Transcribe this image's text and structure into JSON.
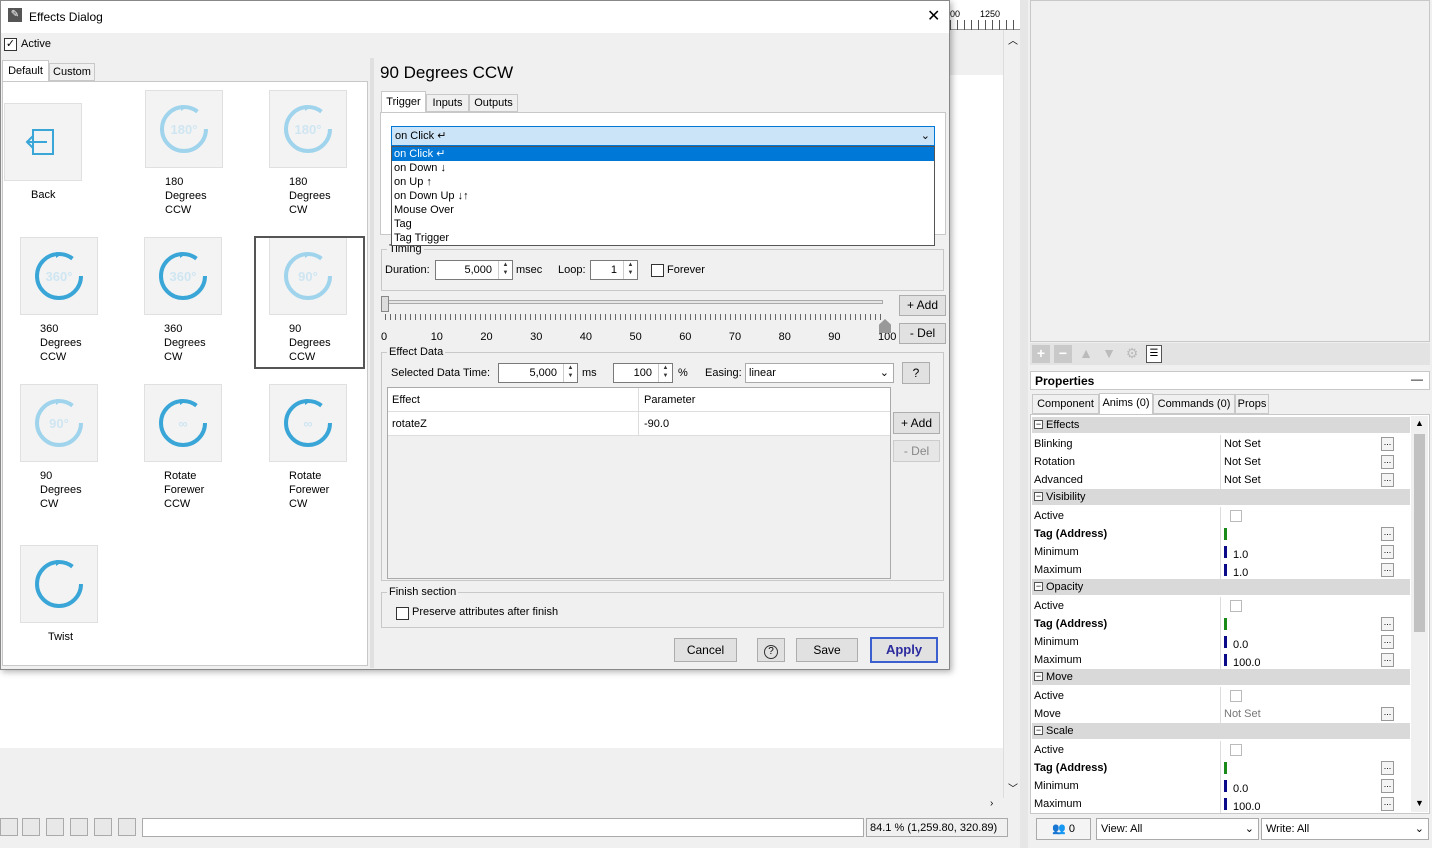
{
  "dialog": {
    "title": "Effects Dialog",
    "active_label": "Active",
    "tabs": [
      "Default",
      "Custom"
    ],
    "tiles": [
      {
        "label": "Back",
        "icon": "back-icon",
        "glyph": ""
      },
      {
        "label": "180\nDegrees\nCCW",
        "icon": "rotate-180-ccw-icon",
        "glyph": "180°"
      },
      {
        "label": "180\nDegrees\nCW",
        "icon": "rotate-180-cw-icon",
        "glyph": "180°"
      },
      {
        "label": "360\nDegrees\nCCW",
        "icon": "rotate-360-ccw-icon",
        "glyph": "360°"
      },
      {
        "label": "360\nDegrees\nCW",
        "icon": "rotate-360-cw-icon",
        "glyph": "360°"
      },
      {
        "label": "90\nDegrees\nCCW",
        "icon": "rotate-90-ccw-icon",
        "glyph": "90°"
      },
      {
        "label": "90\nDegrees\nCW",
        "icon": "rotate-90-cw-icon",
        "glyph": "90°"
      },
      {
        "label": "Rotate\nForewer\nCCW",
        "icon": "rotate-forever-ccw-icon",
        "glyph": "∞"
      },
      {
        "label": "Rotate\nForewer\nCW",
        "icon": "rotate-forever-cw-icon",
        "glyph": "∞"
      },
      {
        "label": "Twist",
        "icon": "twist-icon",
        "glyph": ""
      }
    ],
    "effect_title": "90 Degrees CCW",
    "subtabs": [
      "Trigger",
      "Inputs",
      "Outputs"
    ],
    "trigger_selected": "on Click ↵",
    "trigger_options": [
      "on Click ↵",
      "on Down ↓",
      "on Up ↑",
      "on Down Up ↓↑",
      "Mouse Over",
      "Tag",
      "Tag Trigger"
    ],
    "timing": {
      "legend": "Timing",
      "duration_label": "Duration:",
      "duration_value": "5,000",
      "duration_unit": "msec",
      "loop_label": "Loop:",
      "loop_value": "1",
      "forever_label": "Forever"
    },
    "timeline": {
      "ticks": [
        "0",
        "10",
        "20",
        "30",
        "40",
        "50",
        "60",
        "70",
        "80",
        "90",
        "100"
      ],
      "add_label": "+ Add",
      "del_label": "- Del"
    },
    "effect_data": {
      "legend": "Effect Data",
      "selected_time_label": "Selected Data Time:",
      "selected_time_value": "5,000",
      "ms_label": "ms",
      "percent_value": "100",
      "percent_label": "%",
      "easing_label": "Easing:",
      "easing_value": "linear",
      "help_label": "?",
      "columns": [
        "Effect",
        "Parameter"
      ],
      "rows": [
        {
          "effect": "rotateZ",
          "parameter": "-90.0"
        }
      ],
      "add_label": "+ Add",
      "del_label": "- Del"
    },
    "finish": {
      "legend": "Finish section",
      "preserve_label": "Preserve attributes after finish"
    },
    "buttons": {
      "cancel": "Cancel",
      "help": "?",
      "save": "Save",
      "apply": "Apply"
    }
  },
  "ruler": {
    "label": "1250",
    "left_label": "00"
  },
  "status": {
    "zoom": "84.1 %",
    "coords": "(1,259.80, 320.89)"
  },
  "properties": {
    "title": "Properties",
    "tabs": [
      "Component",
      "Anims (0)",
      "Commands (0)",
      "Props"
    ],
    "sections": [
      {
        "name": "Effects",
        "rows": [
          {
            "name": "Blinking",
            "value": "Not Set",
            "bold": false,
            "kind": "text"
          },
          {
            "name": "Rotation",
            "value": "Not Set",
            "bold": false,
            "kind": "text"
          },
          {
            "name": "Advanced",
            "value": "Not Set",
            "bold": false,
            "kind": "text"
          }
        ]
      },
      {
        "name": "Visibility",
        "rows": [
          {
            "name": "Active",
            "value": "",
            "bold": false,
            "kind": "check"
          },
          {
            "name": "Tag (Address)",
            "value": "",
            "bold": true,
            "kind": "tag-green"
          },
          {
            "name": "Minimum",
            "value": "1.0",
            "bold": false,
            "kind": "num"
          },
          {
            "name": "Maximum",
            "value": "1.0",
            "bold": false,
            "kind": "num"
          }
        ]
      },
      {
        "name": "Opacity",
        "rows": [
          {
            "name": "Active",
            "value": "",
            "bold": false,
            "kind": "check"
          },
          {
            "name": "Tag (Address)",
            "value": "",
            "bold": true,
            "kind": "tag-green"
          },
          {
            "name": "Minimum",
            "value": "0.0",
            "bold": false,
            "kind": "num"
          },
          {
            "name": "Maximum",
            "value": "100.0",
            "bold": false,
            "kind": "num"
          }
        ]
      },
      {
        "name": "Move",
        "rows": [
          {
            "name": "Active",
            "value": "",
            "bold": false,
            "kind": "check"
          },
          {
            "name": "Move",
            "value": "Not Set",
            "bold": false,
            "kind": "gray"
          }
        ]
      },
      {
        "name": "Scale",
        "rows": [
          {
            "name": "Active",
            "value": "",
            "bold": false,
            "kind": "check"
          },
          {
            "name": "Tag (Address)",
            "value": "",
            "bold": true,
            "kind": "tag-green"
          },
          {
            "name": "Minimum",
            "value": "0.0",
            "bold": false,
            "kind": "num"
          },
          {
            "name": "Maximum",
            "value": "100.0",
            "bold": false,
            "kind": "num"
          }
        ]
      }
    ],
    "users_count": "0",
    "view_label": "View: All",
    "write_label": "Write: All"
  }
}
